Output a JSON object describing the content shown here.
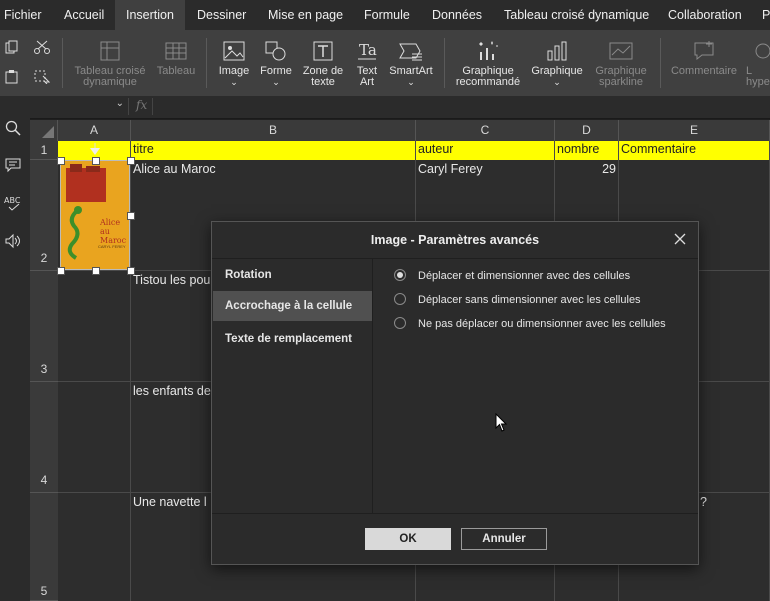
{
  "menu": {
    "items": [
      {
        "label": "Fichier"
      },
      {
        "label": "Accueil"
      },
      {
        "label": "Insertion",
        "active": true
      },
      {
        "label": "Dessiner"
      },
      {
        "label": "Mise en page"
      },
      {
        "label": "Formule"
      },
      {
        "label": "Données"
      },
      {
        "label": "Tableau croisé dynamique"
      },
      {
        "label": "Collaboration"
      },
      {
        "label": "P"
      }
    ]
  },
  "ribbon": {
    "pivot_table": "Tableau croisé dynamique",
    "table": "Tableau",
    "image": "Image",
    "shape": "Forme",
    "textbox": "Zone de texte",
    "text_art": "Text Art",
    "smartart": "SmartArt",
    "recommended_chart": "Graphique recommandé",
    "chart": "Graphique",
    "sparkline": "Graphique sparkline",
    "comment": "Commentaire",
    "hyperlink_partial": "L hype"
  },
  "formula_bar": {
    "fx": "fx",
    "name_box": "",
    "value": ""
  },
  "grid": {
    "columns": [
      "A",
      "B",
      "C",
      "D",
      "E"
    ],
    "rows": [
      "1",
      "2",
      "3",
      "4",
      "5"
    ],
    "header_row": {
      "B": "titre",
      "C": "auteur",
      "D": "nombre",
      "E": "Commentaire"
    },
    "row2": {
      "B": "Alice au Maroc",
      "C": "Caryl Ferey",
      "D": "29"
    },
    "row3": {
      "B": "Tistou les pou"
    },
    "row4": {
      "B": "les enfants de"
    },
    "row5": {
      "B": "Une navette l",
      "E_tail": "?"
    },
    "image_cover_title": "Alice au Maroc",
    "image_cover_author": "CARYL FEREY",
    "highlight_color": "#ffff00"
  },
  "dialog": {
    "title": "Image - Paramètres avancés",
    "tabs": [
      {
        "label": "Rotation"
      },
      {
        "label": "Accrochage à la cellule",
        "active": true
      },
      {
        "label": "Texte de remplacement"
      }
    ],
    "options": [
      {
        "label": "Déplacer et dimensionner avec des cellules",
        "checked": true
      },
      {
        "label": "Déplacer sans dimensionner avec les cellules",
        "checked": false
      },
      {
        "label": "Ne pas déplacer ou dimensionner avec les cellules",
        "checked": false
      }
    ],
    "ok_label": "OK",
    "cancel_label": "Annuler"
  }
}
